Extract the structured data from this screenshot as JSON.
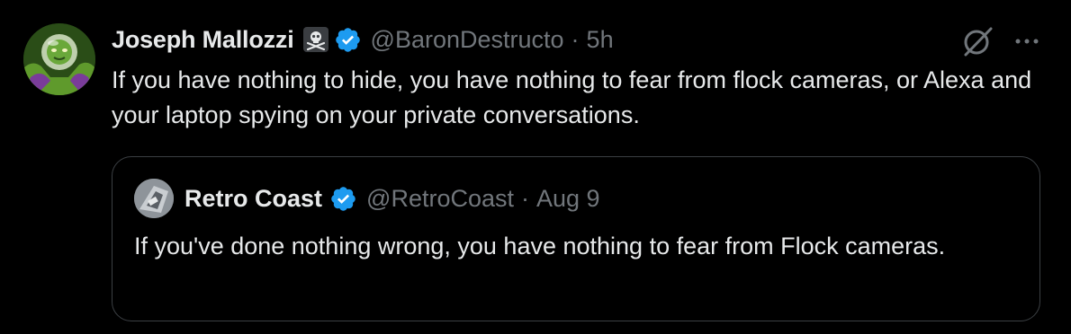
{
  "tweet": {
    "author": {
      "display_name": "Joseph Mallozzi",
      "badge_emoji": "☠",
      "verified": true,
      "handle": "@BaronDestructo",
      "time": "5h",
      "separator": "·"
    },
    "text": "If you have nothing to hide, you have nothing to fear from flock cameras, or Alexa and your laptop spying on your private conversations.",
    "icons": {
      "grok": "grok-icon",
      "more": "more-icon"
    }
  },
  "quote": {
    "author": {
      "display_name": "Retro Coast",
      "verified": true,
      "handle": "@RetroCoast",
      "time": "Aug 9",
      "separator": "·"
    },
    "text": "If you've done nothing wrong, you have nothing to fear from Flock cameras."
  },
  "colors": {
    "background": "#000000",
    "primary_text": "#e7e9ea",
    "secondary_text": "#71767b",
    "verified_blue": "#1d9bf0",
    "border": "#3b3f43"
  }
}
